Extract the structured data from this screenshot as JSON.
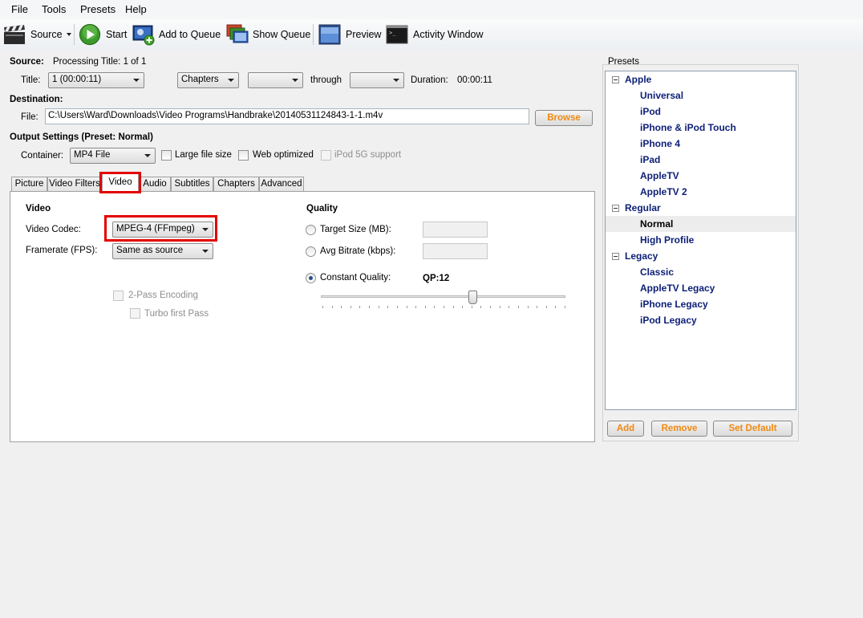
{
  "menu": [
    "File",
    "Tools",
    "Presets",
    "Help"
  ],
  "toolbar": {
    "source": "Source",
    "start": "Start",
    "add_to_queue": "Add to Queue",
    "show_queue": "Show Queue",
    "preview": "Preview",
    "activity_window": "Activity Window"
  },
  "source": {
    "label": "Source:",
    "processing": "Processing Title: 1 of 1",
    "title_label": "Title:",
    "title_value": "1 (00:00:11)",
    "chapters_mode": "Chapters",
    "start_chapter": "",
    "through_label": "through",
    "end_chapter": "",
    "duration_label": "Duration:",
    "duration_value": "00:00:11"
  },
  "destination": {
    "label": "Destination:",
    "file_label": "File:",
    "file_value": "C:\\Users\\Ward\\Downloads\\Video Programs\\Handbrake\\20140531124843-1-1.m4v",
    "browse": "Browse"
  },
  "output": {
    "label": "Output Settings (Preset: Normal)",
    "container_label": "Container:",
    "container_value": "MP4 File",
    "large_file": "Large file size",
    "web_optimized": "Web optimized",
    "ipod_support": "iPod 5G support"
  },
  "tabs": [
    "Picture",
    "Video Filters",
    "Video",
    "Audio",
    "Subtitles",
    "Chapters",
    "Advanced"
  ],
  "video": {
    "section": "Video",
    "codec_label": "Video Codec:",
    "codec_value": "MPEG-4 (FFmpeg)",
    "framerate_label": "Framerate (FPS):",
    "framerate_value": "Same as source",
    "two_pass": "2-Pass Encoding",
    "turbo": "Turbo first Pass"
  },
  "quality": {
    "section": "Quality",
    "target_size": "Target Size (MB):",
    "avg_bitrate": "Avg Bitrate (kbps):",
    "constant_quality": "Constant Quality:",
    "qp": "QP:12",
    "slider_fraction": 0.62
  },
  "presets": {
    "title": "Presets",
    "groups": [
      {
        "name": "Apple",
        "items": [
          "Universal",
          "iPod",
          "iPhone & iPod Touch",
          "iPhone 4",
          "iPad",
          "AppleTV",
          "AppleTV 2"
        ]
      },
      {
        "name": "Regular",
        "items": [
          "Normal",
          "High Profile"
        ]
      },
      {
        "name": "Legacy",
        "items": [
          "Classic",
          "AppleTV Legacy",
          "iPhone Legacy",
          "iPod Legacy"
        ]
      }
    ],
    "add": "Add",
    "remove": "Remove",
    "set_default": "Set Default"
  }
}
